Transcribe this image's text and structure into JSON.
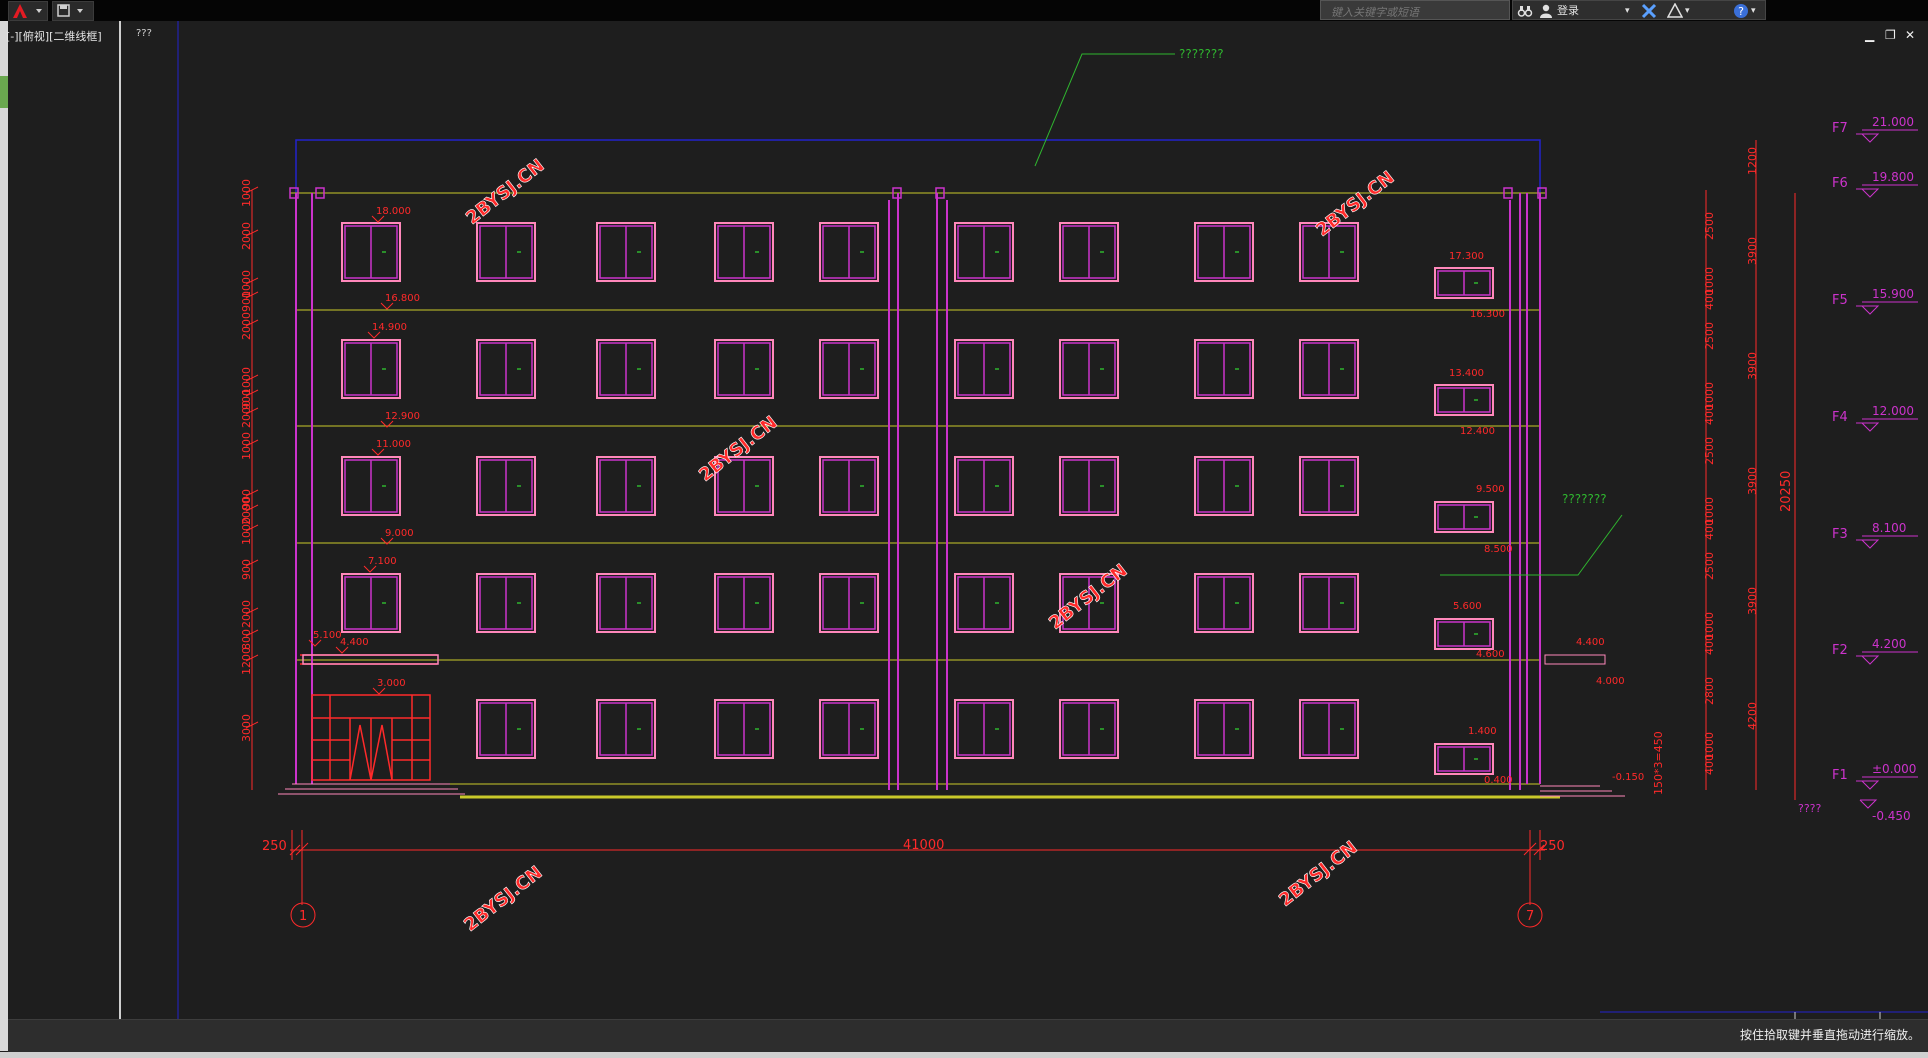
{
  "app": {
    "search_placeholder": "键入关键字或短语",
    "login_label": "登录",
    "viewport_label": "[-][俯视][二维线框]",
    "view_cube_label": "???",
    "status_hint": "按住拾取键并垂直拖动进行缩放。",
    "window_controls": [
      "minimize-icon",
      "restore-icon",
      "close-icon"
    ],
    "toolbar_icons": [
      "autocad-logo-icon",
      "save-icon",
      "binoculars-icon",
      "user-icon",
      "exchange-icon",
      "autodesk360-icon",
      "help-icon"
    ]
  },
  "colors": {
    "background": "#1e1e1e",
    "dimension_red": "#ff2a2a",
    "wall_magenta": "#cc33cc",
    "window_pink": "#ff88bb",
    "floor_yellow": "#c9c92a",
    "annotation_green": "#2fb52f",
    "frame_blue": "#2222cc",
    "watermark": "#ff2a2a"
  },
  "drawing": {
    "leader_text_top": "???????",
    "leader_text_right": "???????",
    "watermark_text": "2BYSJ.CN",
    "total_dimension": "41000",
    "end_dimension_left": "250",
    "end_dimension_right": "250",
    "axis_start": "1",
    "axis_end": "7",
    "left_elev_marks": [
      "18.000",
      "16.800",
      "14.900",
      "12.900",
      "11.000",
      "9.000",
      "7.100",
      "5.100",
      "4.400",
      "3.000"
    ],
    "left_dims": [
      "1000",
      "2000",
      "1000",
      "900",
      "2000",
      "1000",
      "900",
      "2000",
      "1000",
      "900",
      "2000",
      "1000",
      "900",
      "2000",
      "1200",
      "800",
      "3000"
    ],
    "right_elev_marks": [
      "17.300",
      "16.300",
      "13.400",
      "12.400",
      "9.500",
      "8.500",
      "5.600",
      "4.600",
      "1.400",
      "0.400",
      "4.400",
      "4.000",
      "-0.150"
    ],
    "right_dims_col1": [
      "2500",
      "1000",
      "400",
      "2500",
      "1000",
      "400",
      "2500",
      "1000",
      "400",
      "2500",
      "1000",
      "400",
      "2800",
      "1000",
      "400"
    ],
    "right_dims_col2": [
      "1200",
      "3900",
      "3900",
      "3900",
      "3900",
      "4200"
    ],
    "total_height": "20250",
    "step_dim": "150*3=450",
    "floors": [
      {
        "name": "F7",
        "level": "21.000"
      },
      {
        "name": "F6",
        "level": "19.800"
      },
      {
        "name": "F5",
        "level": "15.900"
      },
      {
        "name": "F4",
        "level": "12.000"
      },
      {
        "name": "F3",
        "level": "8.100"
      },
      {
        "name": "F2",
        "level": "4.200"
      },
      {
        "name": "F1",
        "level": "±0.000"
      }
    ],
    "ground_level": "-0.450",
    "ground_text": "????"
  }
}
